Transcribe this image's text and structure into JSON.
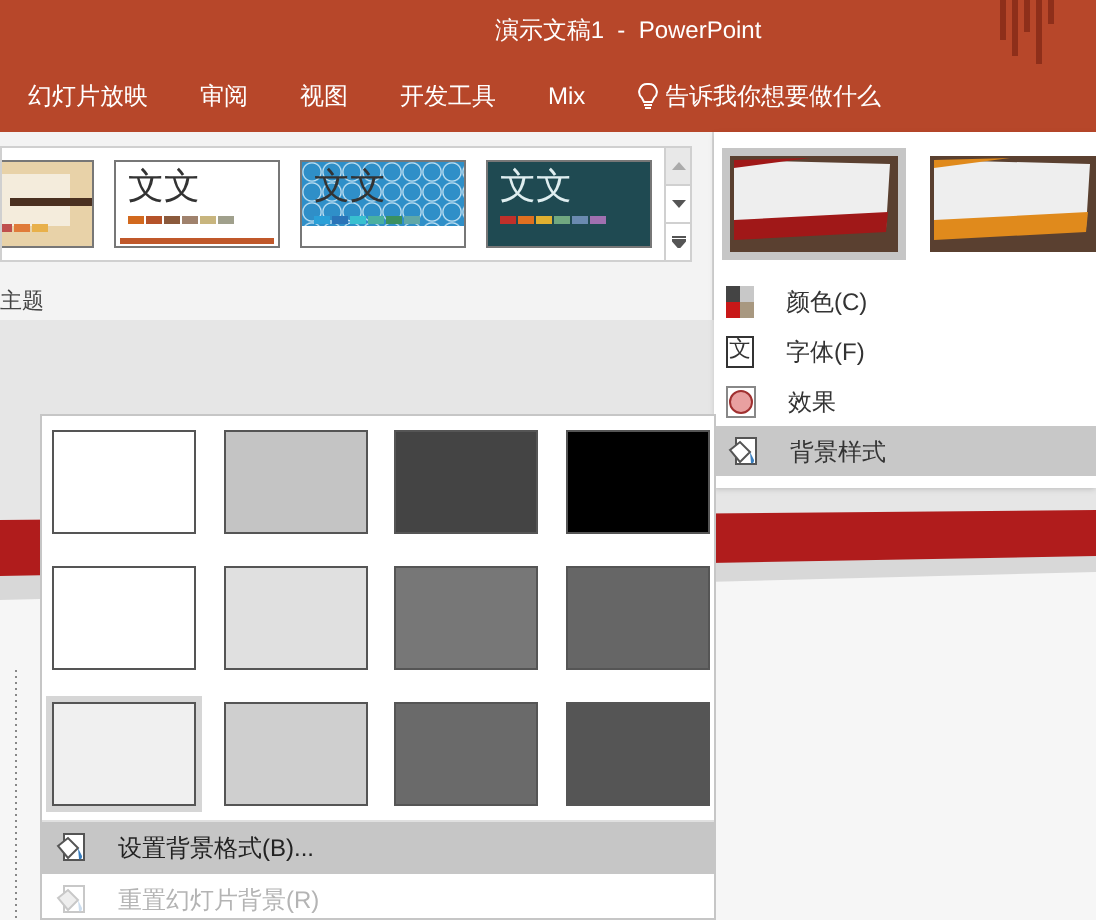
{
  "window": {
    "title": "演示文稿1  -  PowerPoint"
  },
  "tabs": [
    {
      "label": "幻灯片放映"
    },
    {
      "label": "审阅"
    },
    {
      "label": "视图"
    },
    {
      "label": "开发工具"
    },
    {
      "label": "Mix"
    }
  ],
  "tell_me": {
    "placeholder": "告诉我你想要做什么"
  },
  "themes": {
    "label": "主题",
    "items": [
      {
        "kind": "wood",
        "palette": [
          {
            "color": "#c0504d"
          },
          {
            "color": "#e07b39"
          },
          {
            "color": "#e8b04a"
          }
        ]
      },
      {
        "kind": "plain",
        "sample": "文文",
        "palette": [
          {
            "color": "#d2691e"
          },
          {
            "color": "#b5532a"
          },
          {
            "color": "#8b5a3c"
          },
          {
            "color": "#a0826d"
          },
          {
            "color": "#c8b57e"
          },
          {
            "color": "#a0a08c"
          }
        ]
      },
      {
        "kind": "pattern",
        "sample": "文文",
        "palette": [
          {
            "color": "#2aa0d8"
          },
          {
            "color": "#2a74b8"
          },
          {
            "color": "#38c0d0"
          },
          {
            "color": "#4ab0a0"
          },
          {
            "color": "#3a9060"
          },
          {
            "color": "#60a8a8"
          }
        ]
      },
      {
        "kind": "dark",
        "sample": "文文",
        "palette": [
          {
            "color": "#c0302a"
          },
          {
            "color": "#e07020"
          },
          {
            "color": "#e0b030"
          },
          {
            "color": "#70a880"
          },
          {
            "color": "#6a8ab0"
          },
          {
            "color": "#a070b0"
          }
        ]
      }
    ]
  },
  "variants": [
    {
      "color": "#a01818",
      "selected": true
    },
    {
      "color": "#e08a1c",
      "selected": false
    }
  ],
  "variant_menu": [
    {
      "kind": "colors",
      "label": "颜色(C)",
      "highlighted": false
    },
    {
      "kind": "fonts",
      "icon_text": "文",
      "label": "字体(F)",
      "highlighted": false
    },
    {
      "kind": "effects",
      "label": "效果",
      "highlighted": false
    },
    {
      "kind": "background",
      "label": "背景样式",
      "highlighted": true
    }
  ],
  "background_styles": [
    {
      "color": "#ffffff",
      "selected": false
    },
    {
      "color": "#c4c4c4",
      "selected": false
    },
    {
      "color": "#444444",
      "selected": false
    },
    {
      "color": "#000000",
      "selected": false
    },
    {
      "color": "#ffffff",
      "selected": false
    },
    {
      "color": "#e0e0e0",
      "selected": false
    },
    {
      "color": "#777777",
      "selected": false
    },
    {
      "color": "#666666",
      "selected": false
    },
    {
      "color": "#f0f0f0",
      "selected": true
    },
    {
      "color": "#cfcfcf",
      "selected": false
    },
    {
      "color": "#6a6a6a",
      "selected": false
    },
    {
      "color": "#555555",
      "selected": false
    }
  ],
  "background_menu": [
    {
      "label": "设置背景格式(B)...",
      "highlighted": true,
      "disabled": false
    },
    {
      "label": "重置幻灯片背景(R)",
      "highlighted": false,
      "disabled": true
    }
  ]
}
